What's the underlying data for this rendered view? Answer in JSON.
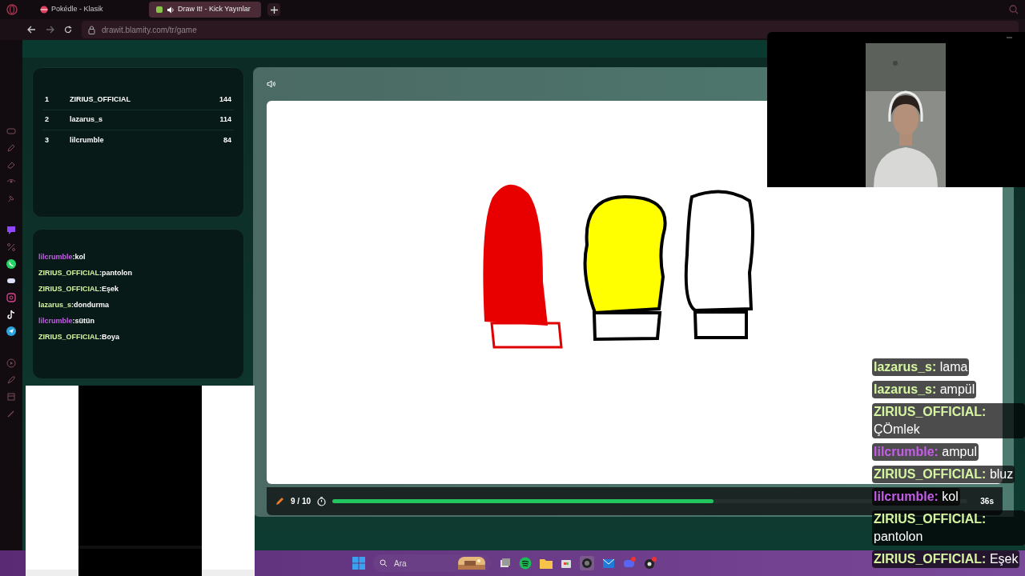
{
  "browser": {
    "tabs": [
      {
        "label": "Pokédle - Klasik",
        "selected": false
      },
      {
        "label": "Draw It! - Kick Yayınlar",
        "selected": true
      }
    ],
    "url": "drawit.blamity.com/tr/game"
  },
  "leaderboard": [
    {
      "rank": "1",
      "name": "ZIRIUS_OFFICIAL",
      "score": "144"
    },
    {
      "rank": "2",
      "name": "lazarus_s",
      "score": "114"
    },
    {
      "rank": "3",
      "name": "lilcrumble",
      "score": "84"
    }
  ],
  "chat": [
    {
      "user": "lilcrumble",
      "text": ":kol",
      "color": "#c45ee6"
    },
    {
      "user": "ZIRIUS_OFFICIAL",
      "text": ":pantolon",
      "color": "#d6f5a0"
    },
    {
      "user": "ZIRIUS_OFFICIAL",
      "text": ":Eşek",
      "color": "#d6f5a0"
    },
    {
      "user": "lazarus_s",
      "text": ":dondurma",
      "color": "#d6f5a0"
    },
    {
      "user": "lilcrumble",
      "text": ":sütün",
      "color": "#c45ee6"
    },
    {
      "user": "ZIRIUS_OFFICIAL",
      "text": ":Boya",
      "color": "#d6f5a0"
    }
  ],
  "round": {
    "counter": "9 / 10",
    "level": 0.6,
    "time": "36s"
  },
  "overlay_chat": [
    {
      "user": "lazarus_s:",
      "text": "lama",
      "color": "#d6f5a0"
    },
    {
      "user": "lazarus_s:",
      "text": "ampül",
      "color": "#d6f5a0"
    },
    {
      "user": "ZIRIUS_OFFICIAL:",
      "text": "ÇÖmlek",
      "color": "#d6f5a0"
    },
    {
      "user": "lilcrumble:",
      "text": "ampul",
      "color": "#c45ee6"
    },
    {
      "user": "ZIRIUS_OFFICIAL:",
      "text": "bluz",
      "color": "#d6f5a0"
    },
    {
      "user": "lilcrumble:",
      "text": "kol",
      "color": "#c45ee6"
    },
    {
      "user": "ZIRIUS_OFFICIAL:",
      "text": "pantolon",
      "color": "#d6f5a0"
    },
    {
      "user": "ZIRIUS_OFFICIAL:",
      "text": "Eşek",
      "color": "#d6f5a0"
    }
  ],
  "taskbar": {
    "search_placeholder": "Ara"
  }
}
